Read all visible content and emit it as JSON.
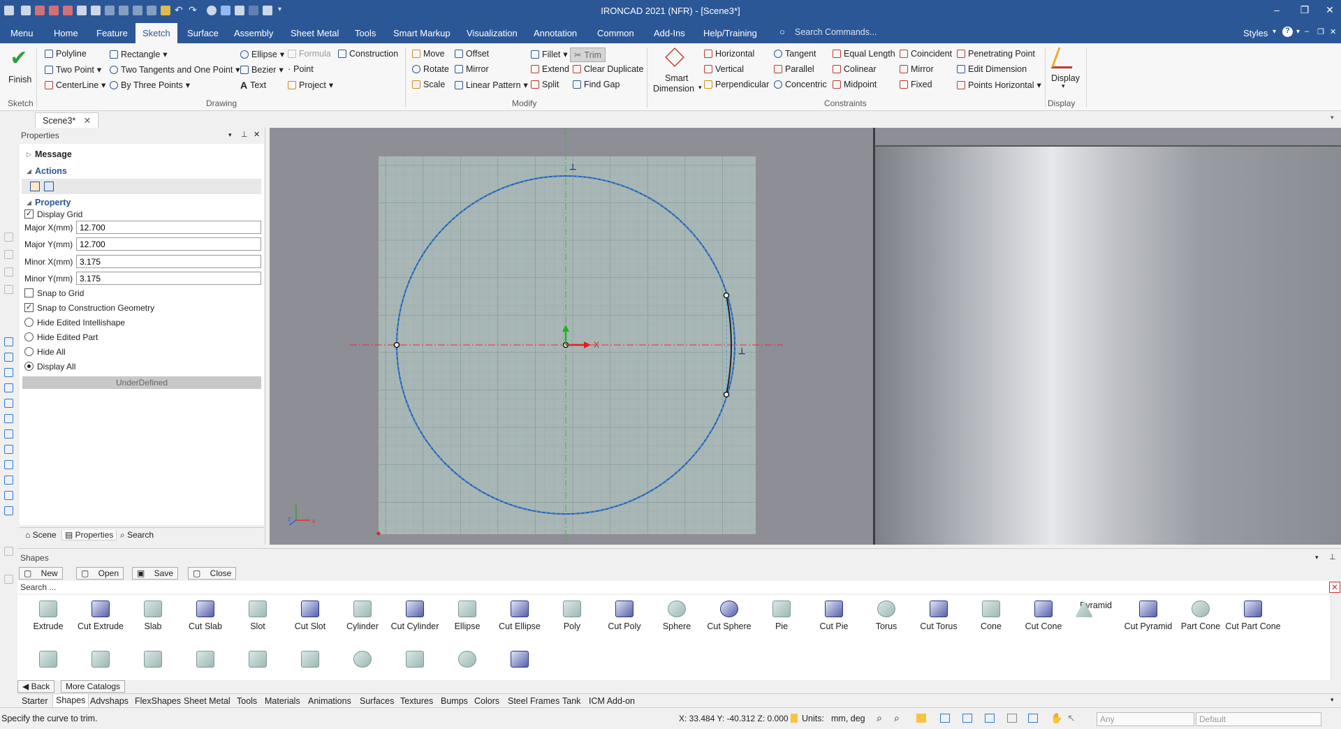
{
  "app": {
    "title": "IRONCAD 2021 (NFR) - [Scene3*]"
  },
  "menu": {
    "tabs": [
      "Menu",
      "Home",
      "Feature",
      "Sketch",
      "Surface",
      "Assembly",
      "Sheet Metal",
      "Tools",
      "Smart Markup",
      "Visualization",
      "Annotation",
      "Common",
      "Add-Ins",
      "Help/Training"
    ],
    "active_tab": "Sketch",
    "search_placeholder": "Search Commands...",
    "styles_label": "Styles"
  },
  "ribbon": {
    "sketch": {
      "finish": "Finish",
      "group": "Sketch"
    },
    "drawing": {
      "items": [
        "Polyline",
        "Two Point",
        "CenterLine",
        "Rectangle",
        "Two Tangents and One Point",
        "By Three Points",
        "Ellipse",
        "Bezier",
        "Text",
        "Formula",
        "Point",
        "Project",
        "Construction"
      ],
      "group": "Drawing"
    },
    "modify": {
      "items": [
        "Move",
        "Rotate",
        "Scale",
        "Offset",
        "Mirror",
        "Linear Pattern",
        "Fillet",
        "Extend",
        "Split",
        "Trim",
        "Clear Duplicate",
        "Find Gap"
      ],
      "group": "Modify"
    },
    "constraints": {
      "smart_dimension_1": "Smart",
      "smart_dimension_2": "Dimension",
      "items": [
        "Horizontal",
        "Vertical",
        "Perpendicular",
        "Tangent",
        "Parallel",
        "Concentric",
        "Equal Length",
        "Colinear",
        "Midpoint",
        "Coincident",
        "Mirror",
        "Fixed",
        "Penetrating Point",
        "Edit Dimension",
        "Points Horizontal"
      ],
      "group": "Constraints"
    },
    "display": {
      "label": "Display",
      "group": "Display"
    }
  },
  "document": {
    "tab": "Scene3*"
  },
  "properties": {
    "title": "Properties",
    "sections": {
      "message": "Message",
      "actions": "Actions",
      "property": "Property"
    },
    "display_grid": "Display Grid",
    "fields": [
      {
        "label": "Major X(mm)",
        "value": "12.700"
      },
      {
        "label": "Major Y(mm)",
        "value": "12.700"
      },
      {
        "label": "Minor X(mm)",
        "value": "3.175"
      },
      {
        "label": "Minor Y(mm)",
        "value": "3.175"
      }
    ],
    "snap_to_grid": "Snap to Grid",
    "snap_to_construction": "Snap to Construction Geometry",
    "radios": [
      "Hide Edited Intellishape",
      "Hide Edited Part",
      "Hide All",
      "Display All"
    ],
    "status": "UnderDefined",
    "tabs": [
      "Scene",
      "Properties",
      "Search"
    ]
  },
  "viewport": {
    "axis_x": "X"
  },
  "shapes": {
    "title": "Shapes",
    "buttons": [
      "New",
      "Open",
      "Save",
      "Close"
    ],
    "search_placeholder": "Search ...",
    "items": [
      "Extrude",
      "Cut Extrude",
      "Slab",
      "Cut Slab",
      "Slot",
      "Cut Slot",
      "Cylinder",
      "Cut Cylinder",
      "Ellipse",
      "Cut Ellipse",
      "Poly",
      "Cut Poly",
      "Sphere",
      "Cut Sphere",
      "Pie",
      "Cut Pie",
      "Torus",
      "Cut Torus",
      "Cone",
      "Cut Cone",
      "Pyramid",
      "Cut Pyramid",
      "Part Cone",
      "Cut Part Cone"
    ],
    "back": "Back",
    "more_catalogs": "More Catalogs"
  },
  "catalog_tabs": [
    "Starter",
    "Shapes",
    "Advshaps",
    "FlexShapes",
    "Sheet Metal",
    "Tools",
    "Materials",
    "Animations",
    "Surfaces",
    "Textures",
    "Bumps",
    "Colors",
    "Steel Frames",
    "Tank",
    "ICM Add-on"
  ],
  "statusbar": {
    "message": "Specify the curve to trim.",
    "coords": "X: 33.484 Y: -40.312 Z: 0.000",
    "units_label": "Units:",
    "units_value": "mm, deg",
    "filter1": "Any",
    "filter2": "Default"
  }
}
